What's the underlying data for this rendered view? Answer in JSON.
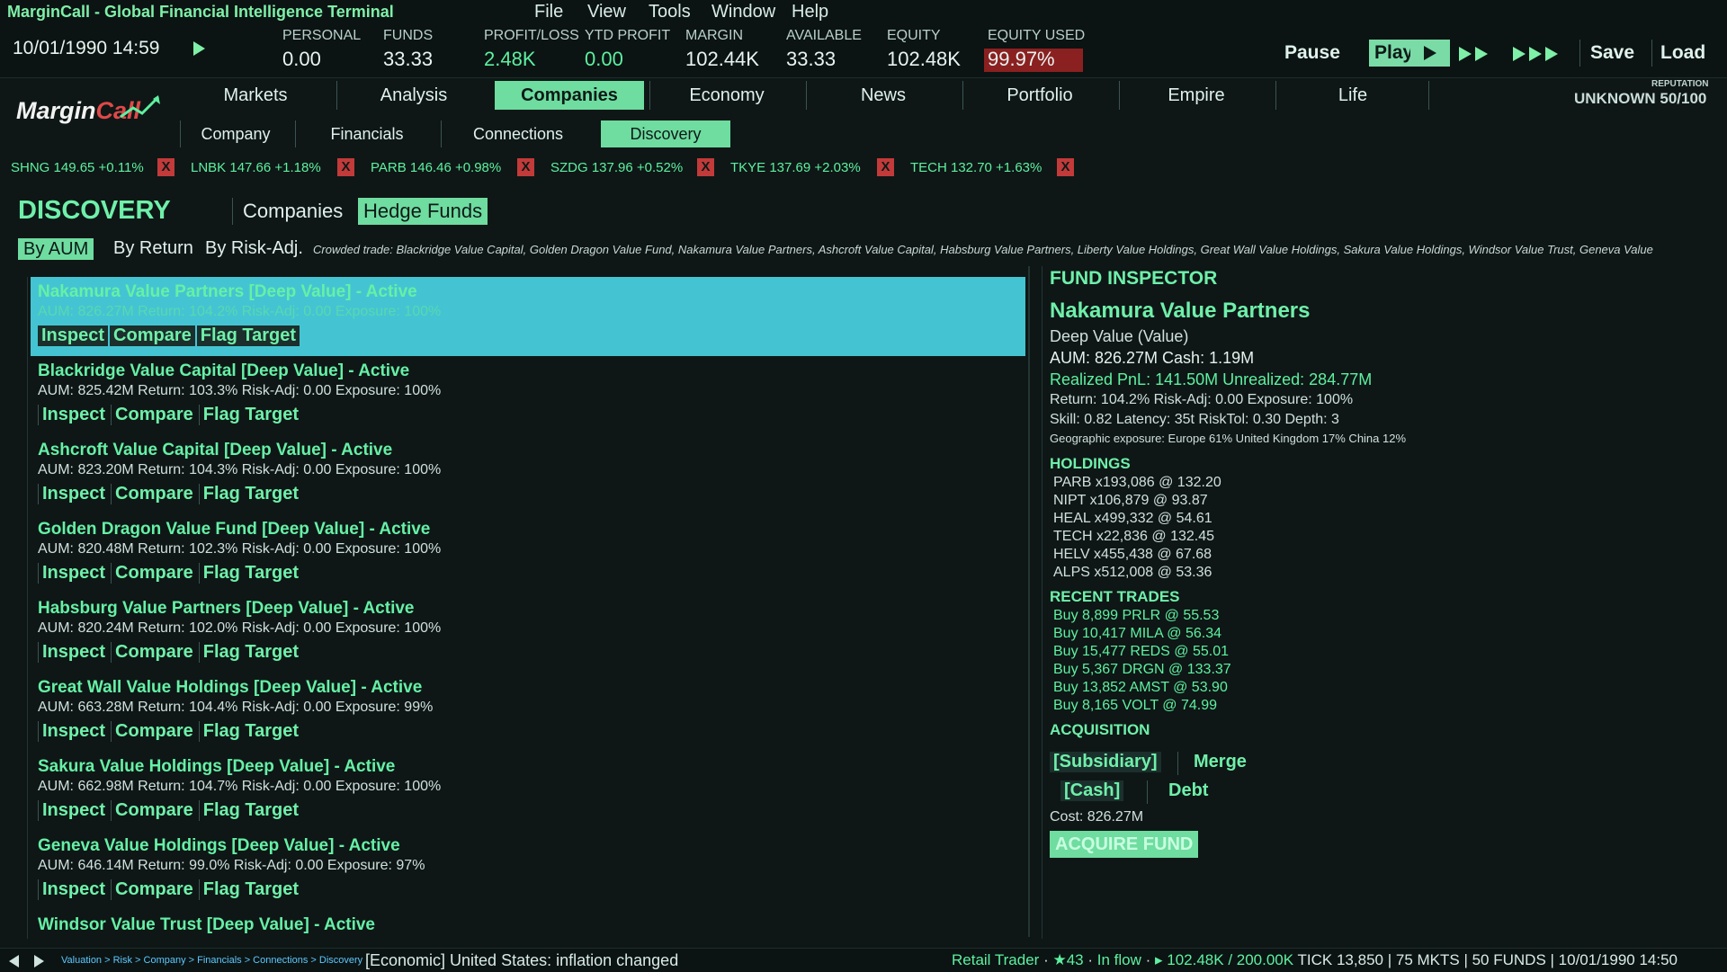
{
  "app": {
    "title": "MarginCall - Global Financial Intelligence Terminal"
  },
  "menu": [
    "File",
    "View",
    "Tools",
    "Window",
    "Help"
  ],
  "status": {
    "datetime": "10/01/1990 14:59",
    "stats": [
      {
        "label": "PERSONAL",
        "value": "0.00"
      },
      {
        "label": "FUNDS",
        "value": "33.33"
      },
      {
        "label": "PROFIT/LOSS",
        "value": "2.48K"
      },
      {
        "label": "YTD PROFIT",
        "value": "0.00"
      },
      {
        "label": "MARGIN",
        "value": "102.44K"
      },
      {
        "label": "AVAILABLE",
        "value": "33.33"
      },
      {
        "label": "EQUITY",
        "value": "102.48K"
      },
      {
        "label": "EQUITY USED",
        "value": "99.97%"
      }
    ],
    "controls": {
      "pause": "Pause",
      "play": "Play",
      "save": "Save",
      "load": "Load"
    }
  },
  "logo": {
    "part1": "Margin",
    "part2": "Call"
  },
  "tabs": [
    "Markets",
    "Analysis",
    "Companies",
    "Economy",
    "News",
    "Portfolio",
    "Empire",
    "Life"
  ],
  "subtabs": [
    "Company",
    "Financials",
    "Connections",
    "Discovery"
  ],
  "reputation": {
    "label": "REPUTATION",
    "value": "UNKNOWN  50/100"
  },
  "ticker": [
    {
      "text": "SHNG 149.65 +0.11%"
    },
    {
      "text": "LNBK 147.66 +1.18%"
    },
    {
      "text": "PARB 146.46 +0.98%"
    },
    {
      "text": "SZDG 137.96 +0.52%"
    },
    {
      "text": "TKYE 137.69 +2.03%"
    },
    {
      "text": "TECH 132.70 +1.63%"
    }
  ],
  "ticker_close": "X",
  "discovery": {
    "title": "DISCOVERY",
    "companies": "Companies",
    "hedge_funds": "Hedge Funds",
    "sort": {
      "aum": "By AUM",
      "return": "By Return",
      "risk": "By Risk-Adj."
    },
    "crowded": "Crowded trade: Blackridge Value Capital, Golden Dragon Value Fund, Nakamura Value Partners, Ashcroft Value Capital, Habsburg Value Partners, Liberty Value Holdings, Great Wall Value Holdings, Sakura Value Holdings, Windsor Value Trust, Geneva Value"
  },
  "fund_buttons": {
    "inspect": "Inspect",
    "compare": "Compare",
    "flag": "Flag Target"
  },
  "funds": [
    {
      "name": "Nakamura Value Partners  [Deep Value]  -  Active",
      "stats": "AUM: 826.27M   Return: 104.2%   Risk-Adj: 0.00   Exposure: 100%"
    },
    {
      "name": "Blackridge Value Capital  [Deep Value]  -  Active",
      "stats": "AUM: 825.42M   Return: 103.3%   Risk-Adj: 0.00   Exposure: 100%"
    },
    {
      "name": "Ashcroft Value Capital  [Deep Value]  -  Active",
      "stats": "AUM: 823.20M   Return: 104.3%   Risk-Adj: 0.00   Exposure: 100%"
    },
    {
      "name": "Golden Dragon Value Fund  [Deep Value]  -  Active",
      "stats": "AUM: 820.48M   Return: 102.3%   Risk-Adj: 0.00   Exposure: 100%"
    },
    {
      "name": "Habsburg Value Partners  [Deep Value]  -  Active",
      "stats": "AUM: 820.24M   Return: 102.0%   Risk-Adj: 0.00   Exposure: 100%"
    },
    {
      "name": "Great Wall Value Holdings  [Deep Value]  -  Active",
      "stats": "AUM: 663.28M   Return: 104.4%   Risk-Adj: 0.00   Exposure: 99%"
    },
    {
      "name": "Sakura Value Holdings  [Deep Value]  -  Active",
      "stats": "AUM: 662.98M   Return: 104.7%   Risk-Adj: 0.00   Exposure: 100%"
    },
    {
      "name": "Geneva Value Holdings  [Deep Value]  -  Active",
      "stats": "AUM: 646.14M   Return: 99.0%   Risk-Adj: 0.00   Exposure: 97%"
    },
    {
      "name": "Windsor Value Trust  [Deep Value]  -  Active",
      "stats": ""
    }
  ],
  "inspector": {
    "header": "FUND INSPECTOR",
    "name": "Nakamura Value Partners",
    "strategy": "Deep Value (Value)",
    "aum_cash": "AUM: 826.27M   Cash: 1.19M",
    "pnl": "Realized PnL: 141.50M   Unrealized: 284.77M",
    "return_line": "Return: 104.2%   Risk-Adj: 0.00   Exposure: 100%",
    "skill_line": "Skill: 0.82   Latency: 35t   RiskTol: 0.30   Depth: 3",
    "geo": "Geographic exposure: Europe 61%   United Kingdom 17%   China 12%",
    "holdings_label": "HOLDINGS",
    "holdings": [
      "PARB  x193,086  @ 132.20",
      "NIPT  x106,879  @ 93.87",
      "HEAL  x499,332  @ 54.61",
      "TECH  x22,836  @ 132.45",
      "HELV  x455,438  @ 67.68",
      "ALPS  x512,008  @ 53.36"
    ],
    "trades_label": "RECENT TRADES",
    "trades": [
      "Buy 8,899 PRLR @ 55.53",
      "Buy 10,417 MILA @ 56.34",
      "Buy 15,477 REDS @ 55.01",
      "Buy 5,367 DRGN @ 133.37",
      "Buy 13,852 AMST @ 53.90",
      "Buy 8,165 VOLT @ 74.99"
    ],
    "acq_label": "ACQUISITION",
    "acq_subsidiary": "[Subsidiary]",
    "acq_merge": "Merge",
    "acq_cash": "[Cash]",
    "acq_debt": "Debt",
    "cost": "Cost: 826.27M",
    "acquire": "ACQUIRE FUND"
  },
  "bottom": {
    "breadcrumb": "Valuation > Risk > Company > Financials > Connections > Discovery",
    "message": "[Economic] United States: inflation changed",
    "trader": "Retail Trader",
    "stars": "★43",
    "flow": "In flow",
    "equity": "▸ 102.48K / 200.00K",
    "tick": "TICK 13,850",
    "mkts": "75 MKTS",
    "funds": "50 FUNDS",
    "time": "10/01/1990 14:50"
  }
}
